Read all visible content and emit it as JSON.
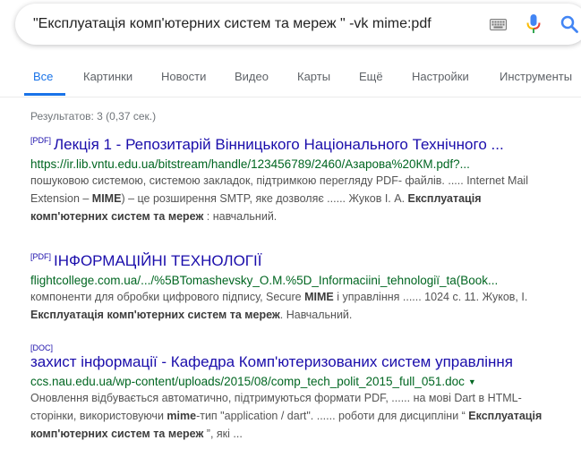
{
  "search": {
    "query": "\"Експлуатація комп'ютерних систем та мереж \" -vk mime:pdf"
  },
  "tabs": [
    {
      "label": "Все",
      "active": true
    },
    {
      "label": "Картинки"
    },
    {
      "label": "Новости"
    },
    {
      "label": "Видео"
    },
    {
      "label": "Карты"
    },
    {
      "label": "Ещё"
    },
    {
      "label": "Настройки"
    },
    {
      "label": "Инструменты"
    }
  ],
  "stats": "Результатов: 3 (0,37 сек.)",
  "results": [
    {
      "filetype": "[PDF]",
      "title": "Лекція 1 - Репозитарій Вінницького Національного Технічного ...",
      "url": "https://ir.lib.vntu.edu.ua/bitstream/handle/123456789/2460/Азарова%20КМ.pdf?...",
      "snippet": [
        {
          "t": "пошуковою системою, системою закладок, підтримкою перегляду PDF- файлів. ..... Internet Mail Extension – "
        },
        {
          "t": "MIME",
          "b": true
        },
        {
          "t": ") – це розширення SMTP, яке дозволяє ...... Жуков І. А. "
        },
        {
          "t": "Експлуатація комп'ютерних систем та мереж",
          "b": true
        },
        {
          "t": " : навчальний."
        }
      ]
    },
    {
      "filetype": "[PDF]",
      "title": "ІНФОРМАЦІЙНІ ТЕХНОЛОГІЇ",
      "url": "flightcollege.com.ua/.../%5BTomashevsky_O.M.%5D_Informaciini_tehnologiї_ta(Book...",
      "snippet": [
        {
          "t": "компоненти для обробки цифрового підпису, Secure "
        },
        {
          "t": "MIME",
          "b": true
        },
        {
          "t": " і управління ...... 1024 с. 11. Жуков, І. "
        },
        {
          "t": "Експлуатація комп'ютерних систем та мереж",
          "b": true
        },
        {
          "t": ". Навчальний."
        }
      ]
    },
    {
      "filetype": "[DOC]",
      "title": "захист інформації - Кафедра Комп'ютеризованих систем управління",
      "url": "ccs.nau.edu.ua/wp-content/uploads/2015/08/comp_tech_polit_2015_full_051.doc",
      "snippet": [
        {
          "t": "Оновлення відбувається автоматично, підтримуються формати PDF, ...... на мові Dart в HTML-сторінки, використовуючи "
        },
        {
          "t": "mime",
          "b": true
        },
        {
          "t": "-тип \"application / dart\". ...... роботи для дисципліни “ "
        },
        {
          "t": "Експлуатація комп'ютерних систем та мереж",
          "b": true
        },
        {
          "t": " ”, які ..."
        }
      ]
    }
  ],
  "colors": {
    "accent": "#1a73e8",
    "link": "#1a0dab",
    "url": "#006621",
    "mic_blue": "#4285f4",
    "mic_red": "#ea4335",
    "mic_yellow": "#fbbc05",
    "mic_green": "#34a853"
  },
  "icons": [
    "keyboard-icon",
    "mic-icon",
    "search-icon",
    "dropdown-caret-icon"
  ]
}
